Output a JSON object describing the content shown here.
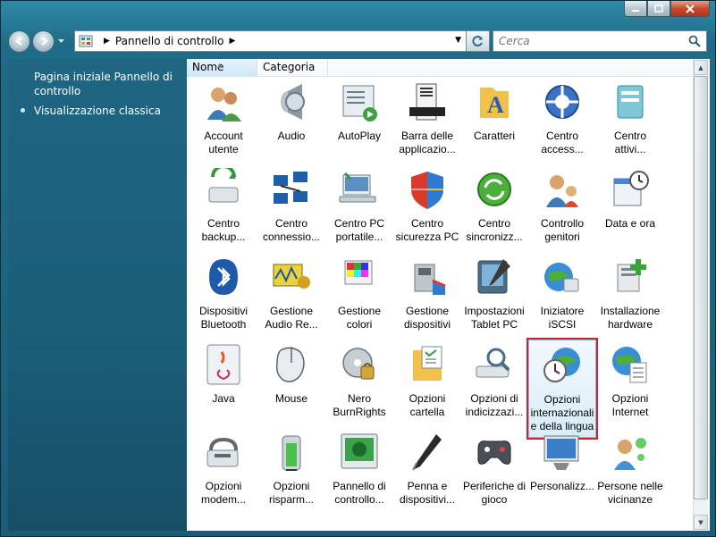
{
  "window": {
    "address": {
      "crumb": "Pannello di controllo"
    },
    "search": {
      "placeholder": "Cerca"
    }
  },
  "leftpane": {
    "links": [
      {
        "label": "Pagina iniziale Pannello di controllo"
      },
      {
        "label": "Visualizzazione classica",
        "active": true
      }
    ]
  },
  "columns": {
    "nome": "Nome",
    "categoria": "Categoria"
  },
  "items": [
    [
      "Account",
      "utente"
    ],
    [
      "Audio"
    ],
    [
      "AutoPlay"
    ],
    [
      "Barra delle",
      "applicazio..."
    ],
    [
      "Caratteri"
    ],
    [
      "Centro",
      "access..."
    ],
    [
      "Centro",
      "attivi..."
    ],
    [
      "Centro",
      "backup..."
    ],
    [
      "Centro",
      "connessio..."
    ],
    [
      "Centro PC",
      "portatile..."
    ],
    [
      "Centro",
      "sicurezza PC"
    ],
    [
      "Centro",
      "sincronizz..."
    ],
    [
      "Controllo",
      "genitori"
    ],
    [
      "Data e ora"
    ],
    [
      "Dispositivi",
      "Bluetooth"
    ],
    [
      "Gestione",
      "Audio Re..."
    ],
    [
      "Gestione",
      "colori"
    ],
    [
      "Gestione",
      "dispositivi"
    ],
    [
      "Impostazioni",
      "Tablet PC"
    ],
    [
      "Iniziatore",
      "iSCSI"
    ],
    [
      "Installazione",
      "hardware"
    ],
    [
      "Java"
    ],
    [
      "Mouse"
    ],
    [
      "Nero",
      "BurnRights"
    ],
    [
      "Opzioni",
      "cartella"
    ],
    [
      "Opzioni di",
      "indicizzazi..."
    ],
    [
      "Opzioni",
      "internazionali",
      "e della lingua"
    ],
    [
      "Opzioni",
      "Internet"
    ],
    [
      "Opzioni",
      "modem..."
    ],
    [
      "Opzioni",
      "risparm..."
    ],
    [
      "Pannello di",
      "controllo..."
    ],
    [
      "Penna e",
      "dispositivi..."
    ],
    [
      "Periferiche di",
      "gioco"
    ],
    [
      "Personalizz..."
    ],
    [
      "Persone nelle",
      "vicinanze"
    ]
  ],
  "selected_item": "Opzioni internazionali e della lingua",
  "colors": {
    "selection_outline": "#d4202b",
    "pane_background": "#1a5d79"
  }
}
